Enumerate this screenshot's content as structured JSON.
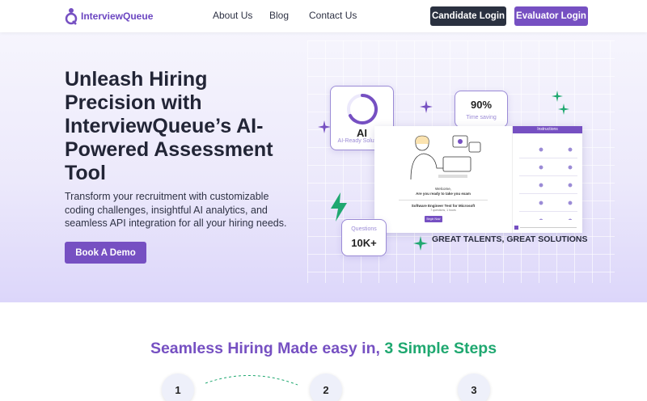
{
  "header": {
    "brand": "InterviewQueue",
    "nav": [
      "About Us",
      "Blog",
      "Contact Us"
    ],
    "candidate_login": "Candidate Login",
    "evaluator_login": "Evaluator Login"
  },
  "hero": {
    "title": "Unleash Hiring Precision with InterviewQueue’s AI-Powered Assessment Tool",
    "subtitle": "Transform your recruitment with customizable coding challenges, insightful AI analytics, and seamless API integration for all your hiring needs.",
    "cta": "Book A Demo",
    "ai_card": {
      "title": "AI",
      "caption": "AI-Ready Solutions"
    },
    "time_card": {
      "value": "90%",
      "caption": "Time saving"
    },
    "questions_card": {
      "caption": "Questions",
      "value": "10K+"
    },
    "tagline": "GREAT TALENTS, GREAT SOLUTIONS",
    "mock": {
      "welcome": "Welcome,",
      "ready": "Are you ready to take you exam",
      "test_name": "Software Engineer Test for Microsoft",
      "test_meta": "7 questions, 1 hours",
      "begin": "Begin Now",
      "instructions": "Instructions"
    }
  },
  "steps": {
    "title_main": "Seamless Hiring Made easy in, ",
    "title_accent": "3 Simple Steps",
    "numbers": [
      "1",
      "2",
      "3"
    ]
  },
  "colors": {
    "primary": "#7650c2",
    "dark": "#2a3140",
    "accent": "#1fa870"
  }
}
